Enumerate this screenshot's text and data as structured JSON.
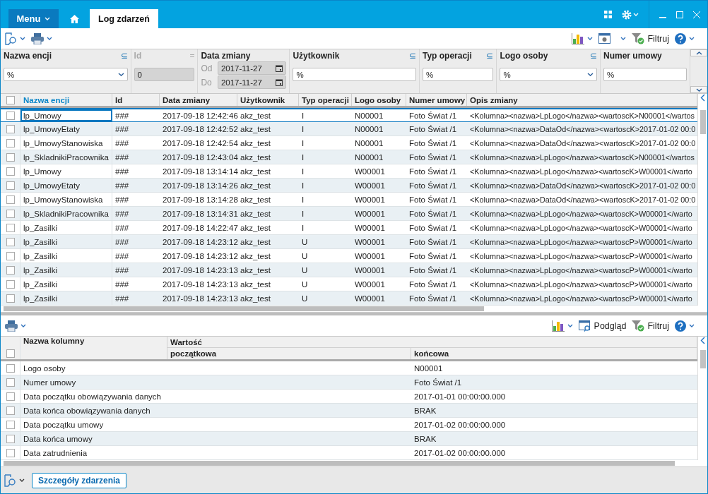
{
  "title_bar": {
    "menu_label": "Menu",
    "tabs": [
      {
        "label": "Log zdarzeń",
        "selected": true
      }
    ]
  },
  "toolbar": {
    "filter_label": "Filtruj"
  },
  "filters": [
    {
      "kind": "select",
      "label": "Nazwa encji",
      "operator": "⊆",
      "value": "%"
    },
    {
      "kind": "number",
      "label": "Id",
      "operator": "=",
      "value": "0",
      "disabled": true
    },
    {
      "kind": "daterange",
      "label": "Data zmiany",
      "from_label": "Od",
      "from": "2017-11-27",
      "to_label": "Do",
      "to": "2017-11-27"
    },
    {
      "kind": "text",
      "label": "Użytkownik",
      "operator": "⊆",
      "value": "%"
    },
    {
      "kind": "text",
      "label": "Typ operacji",
      "operator": "⊆",
      "value": "%"
    },
    {
      "kind": "select",
      "label": "Logo osoby",
      "operator": "⊆",
      "value": "%"
    },
    {
      "kind": "text",
      "label": "Numer umowy",
      "value": "%"
    }
  ],
  "table": {
    "all_checked": false,
    "columns": [
      {
        "label": "Nazwa encji",
        "sorted": true
      },
      {
        "label": "Id",
        "sorted": false
      },
      {
        "label": "Data zmiany",
        "sorted": false
      },
      {
        "label": "Użytkownik",
        "sorted": false
      },
      {
        "label": "Typ operacji",
        "sorted": false
      },
      {
        "label": "Logo osoby",
        "sorted": false
      },
      {
        "label": "Numer umowy",
        "sorted": false
      },
      {
        "label": "Opis zmiany",
        "sorted": false
      }
    ],
    "rows": [
      {
        "selected": true,
        "checked": false,
        "cells": [
          "lp_Umowy",
          "###",
          "2017-09-18 12:42:46",
          "akz_test",
          "I",
          "N00001",
          "Foto Świat /1",
          "<Kolumna><nazwa>LpLogo</nazwa><wartoscK>N00001</wartos"
        ]
      },
      {
        "selected": false,
        "checked": false,
        "cells": [
          "lp_UmowyEtaty",
          "###",
          "2017-09-18 12:42:52",
          "akz_test",
          "I",
          "N00001",
          "Foto Świat /1",
          "<Kolumna><nazwa>DataOd</nazwa><wartoscK>2017-01-02 00:0"
        ]
      },
      {
        "selected": false,
        "checked": false,
        "cells": [
          "lp_UmowyStanowiska",
          "###",
          "2017-09-18 12:42:54",
          "akz_test",
          "I",
          "N00001",
          "Foto Świat /1",
          "<Kolumna><nazwa>DataOd</nazwa><wartoscK>2017-01-02 00:0"
        ]
      },
      {
        "selected": false,
        "checked": false,
        "cells": [
          "lp_SkladnikiPracownika",
          "###",
          "2017-09-18 12:43:04",
          "akz_test",
          "I",
          "N00001",
          "Foto Świat /1",
          "<Kolumna><nazwa>LpLogo</nazwa><wartoscK>N00001</wartos"
        ]
      },
      {
        "selected": false,
        "checked": false,
        "cells": [
          "lp_Umowy",
          "###",
          "2017-09-18 13:14:14",
          "akz_test",
          "I",
          "W00001",
          "Foto Świat /1",
          "<Kolumna><nazwa>LpLogo</nazwa><wartoscK>W00001</warto"
        ]
      },
      {
        "selected": false,
        "checked": false,
        "cells": [
          "lp_UmowyEtaty",
          "###",
          "2017-09-18 13:14:26",
          "akz_test",
          "I",
          "W00001",
          "Foto Świat /1",
          "<Kolumna><nazwa>DataOd</nazwa><wartoscK>2017-01-02 00:0"
        ]
      },
      {
        "selected": false,
        "checked": false,
        "cells": [
          "lp_UmowyStanowiska",
          "###",
          "2017-09-18 13:14:28",
          "akz_test",
          "I",
          "W00001",
          "Foto Świat /1",
          "<Kolumna><nazwa>DataOd</nazwa><wartoscK>2017-01-02 00:0"
        ]
      },
      {
        "selected": false,
        "checked": false,
        "cells": [
          "lp_SkladnikiPracownika",
          "###",
          "2017-09-18 13:14:31",
          "akz_test",
          "I",
          "W00001",
          "Foto Świat /1",
          "<Kolumna><nazwa>LpLogo</nazwa><wartoscK>W00001</warto"
        ]
      },
      {
        "selected": false,
        "checked": false,
        "cells": [
          "lp_Zasilki",
          "###",
          "2017-09-18 14:22:47",
          "akz_test",
          "I",
          "W00001",
          "Foto Świat /1",
          "<Kolumna><nazwa>LpLogo</nazwa><wartoscK>W00001</warto"
        ]
      },
      {
        "selected": false,
        "checked": false,
        "cells": [
          "lp_Zasilki",
          "###",
          "2017-09-18 14:23:12",
          "akz_test",
          "U",
          "W00001",
          "Foto Świat /1",
          "<Kolumna><nazwa>LpLogo</nazwa><wartoscP>W00001</warto"
        ]
      },
      {
        "selected": false,
        "checked": false,
        "cells": [
          "lp_Zasilki",
          "###",
          "2017-09-18 14:23:12",
          "akz_test",
          "U",
          "W00001",
          "Foto Świat /1",
          "<Kolumna><nazwa>LpLogo</nazwa><wartoscP>W00001</warto"
        ]
      },
      {
        "selected": false,
        "checked": false,
        "cells": [
          "lp_Zasilki",
          "###",
          "2017-09-18 14:23:13",
          "akz_test",
          "U",
          "W00001",
          "Foto Świat /1",
          "<Kolumna><nazwa>LpLogo</nazwa><wartoscP>W00001</warto"
        ]
      },
      {
        "selected": false,
        "checked": false,
        "cells": [
          "lp_Zasilki",
          "###",
          "2017-09-18 14:23:13",
          "akz_test",
          "U",
          "W00001",
          "Foto Świat /1",
          "<Kolumna><nazwa>LpLogo</nazwa><wartoscP>W00001</warto"
        ]
      },
      {
        "selected": false,
        "checked": false,
        "cells": [
          "lp_Zasilki",
          "###",
          "2017-09-18 14:23:13",
          "akz_test",
          "U",
          "W00001",
          "Foto Świat /1",
          "<Kolumna><nazwa>LpLogo</nazwa><wartoscP>W00001</warto"
        ]
      }
    ]
  },
  "detail_toolbar": {
    "preview_label": "Podgląd",
    "filter_label": "Filtruj"
  },
  "detail_table": {
    "all_checked": false,
    "name_column": "Nazwa kolumny",
    "value_column": "Wartość",
    "initial_column": "początkowa",
    "final_column": "końcowa",
    "rows": [
      {
        "checked": false,
        "name": "Logo osoby",
        "final": "N00001"
      },
      {
        "checked": false,
        "name": "Numer umowy",
        "final": "Foto Świat /1"
      },
      {
        "checked": false,
        "name": "Data początku obowiązywania danych",
        "final": "2017-01-01 00:00:00.000"
      },
      {
        "checked": false,
        "name": "Data końca obowiązywania danych",
        "final": "BRAK"
      },
      {
        "checked": false,
        "name": "Data początku umowy",
        "final": "2017-01-02 00:00:00.000"
      },
      {
        "checked": false,
        "name": "Data końca umowy",
        "final": "BRAK"
      },
      {
        "checked": false,
        "name": "Data zatrudnienia",
        "final": "2017-01-02 00:00:00.000"
      }
    ]
  },
  "footer": {
    "button_label": "Szczegóły zdarzenia"
  }
}
